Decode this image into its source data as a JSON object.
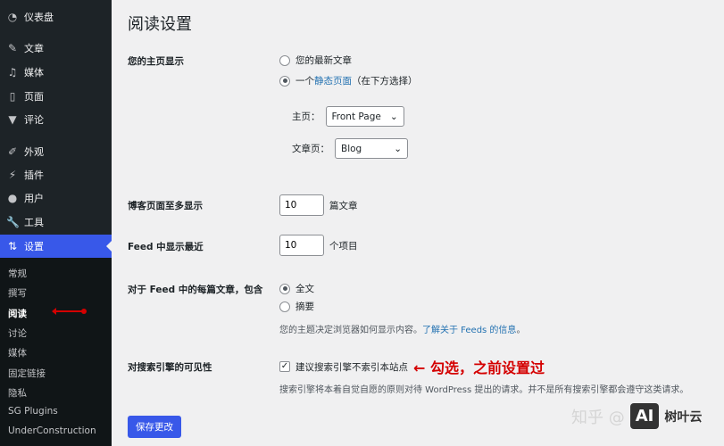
{
  "sidebar": {
    "menu": [
      {
        "label": "仪表盘",
        "icon": "dashboard-icon",
        "glyph": "◔"
      },
      {
        "label": "文章",
        "icon": "pin-icon",
        "glyph": "✎"
      },
      {
        "label": "媒体",
        "icon": "media-icon",
        "glyph": "♫"
      },
      {
        "label": "页面",
        "icon": "page-icon",
        "glyph": "▯"
      },
      {
        "label": "评论",
        "icon": "comment-icon",
        "glyph": "▼"
      },
      {
        "label": "外观",
        "icon": "brush-icon",
        "glyph": "✐"
      },
      {
        "label": "插件",
        "icon": "plugin-icon",
        "glyph": "⚡"
      },
      {
        "label": "用户",
        "icon": "user-icon",
        "glyph": "●"
      },
      {
        "label": "工具",
        "icon": "wrench-icon",
        "glyph": "🔧"
      },
      {
        "label": "设置",
        "icon": "settings-icon",
        "glyph": "⇅"
      }
    ],
    "submenu": [
      "常规",
      "撰写",
      "阅读",
      "讨论",
      "媒体",
      "固定链接",
      "隐私",
      "SG Plugins",
      "UnderConstruction"
    ]
  },
  "page": {
    "title": "阅读设置",
    "homepage": {
      "label": "您的主页显示",
      "opt1": "您的最新文章",
      "opt2_pre": "一个",
      "opt2_link": "静态页面",
      "opt2_post": "（在下方选择）",
      "front_label": "主页：",
      "front_value": "Front Page",
      "posts_label": "文章页：",
      "posts_value": "Blog"
    },
    "per_page": {
      "label": "博客页面至多显示",
      "value": "10",
      "unit": "篇文章"
    },
    "feed": {
      "label": "Feed 中显示最近",
      "value": "10",
      "unit": "个项目"
    },
    "feed_content": {
      "label": "对于 Feed 中的每篇文章，包含",
      "opt1": "全文",
      "opt2": "摘要",
      "desc": "您的主题决定浏览器如何显示内容。",
      "link": "了解关于 Feeds 的信息",
      "end": "。"
    },
    "search": {
      "label": "对搜索引擎的可见性",
      "checkbox": "建议搜索引擎不索引本站点",
      "annotation": "← 勾选，之前设置过",
      "desc": "搜索引擎将本着自觉自愿的原则对待 WordPress 提出的请求。并不是所有搜索引擎都会遵守这类请求。"
    },
    "save": "保存更改"
  },
  "watermark": {
    "zhihu": "知乎 @",
    "ai": "AI",
    "brand": "树叶云"
  },
  "colors": {
    "accent": "#3858e9",
    "annotation": "#d40000"
  }
}
